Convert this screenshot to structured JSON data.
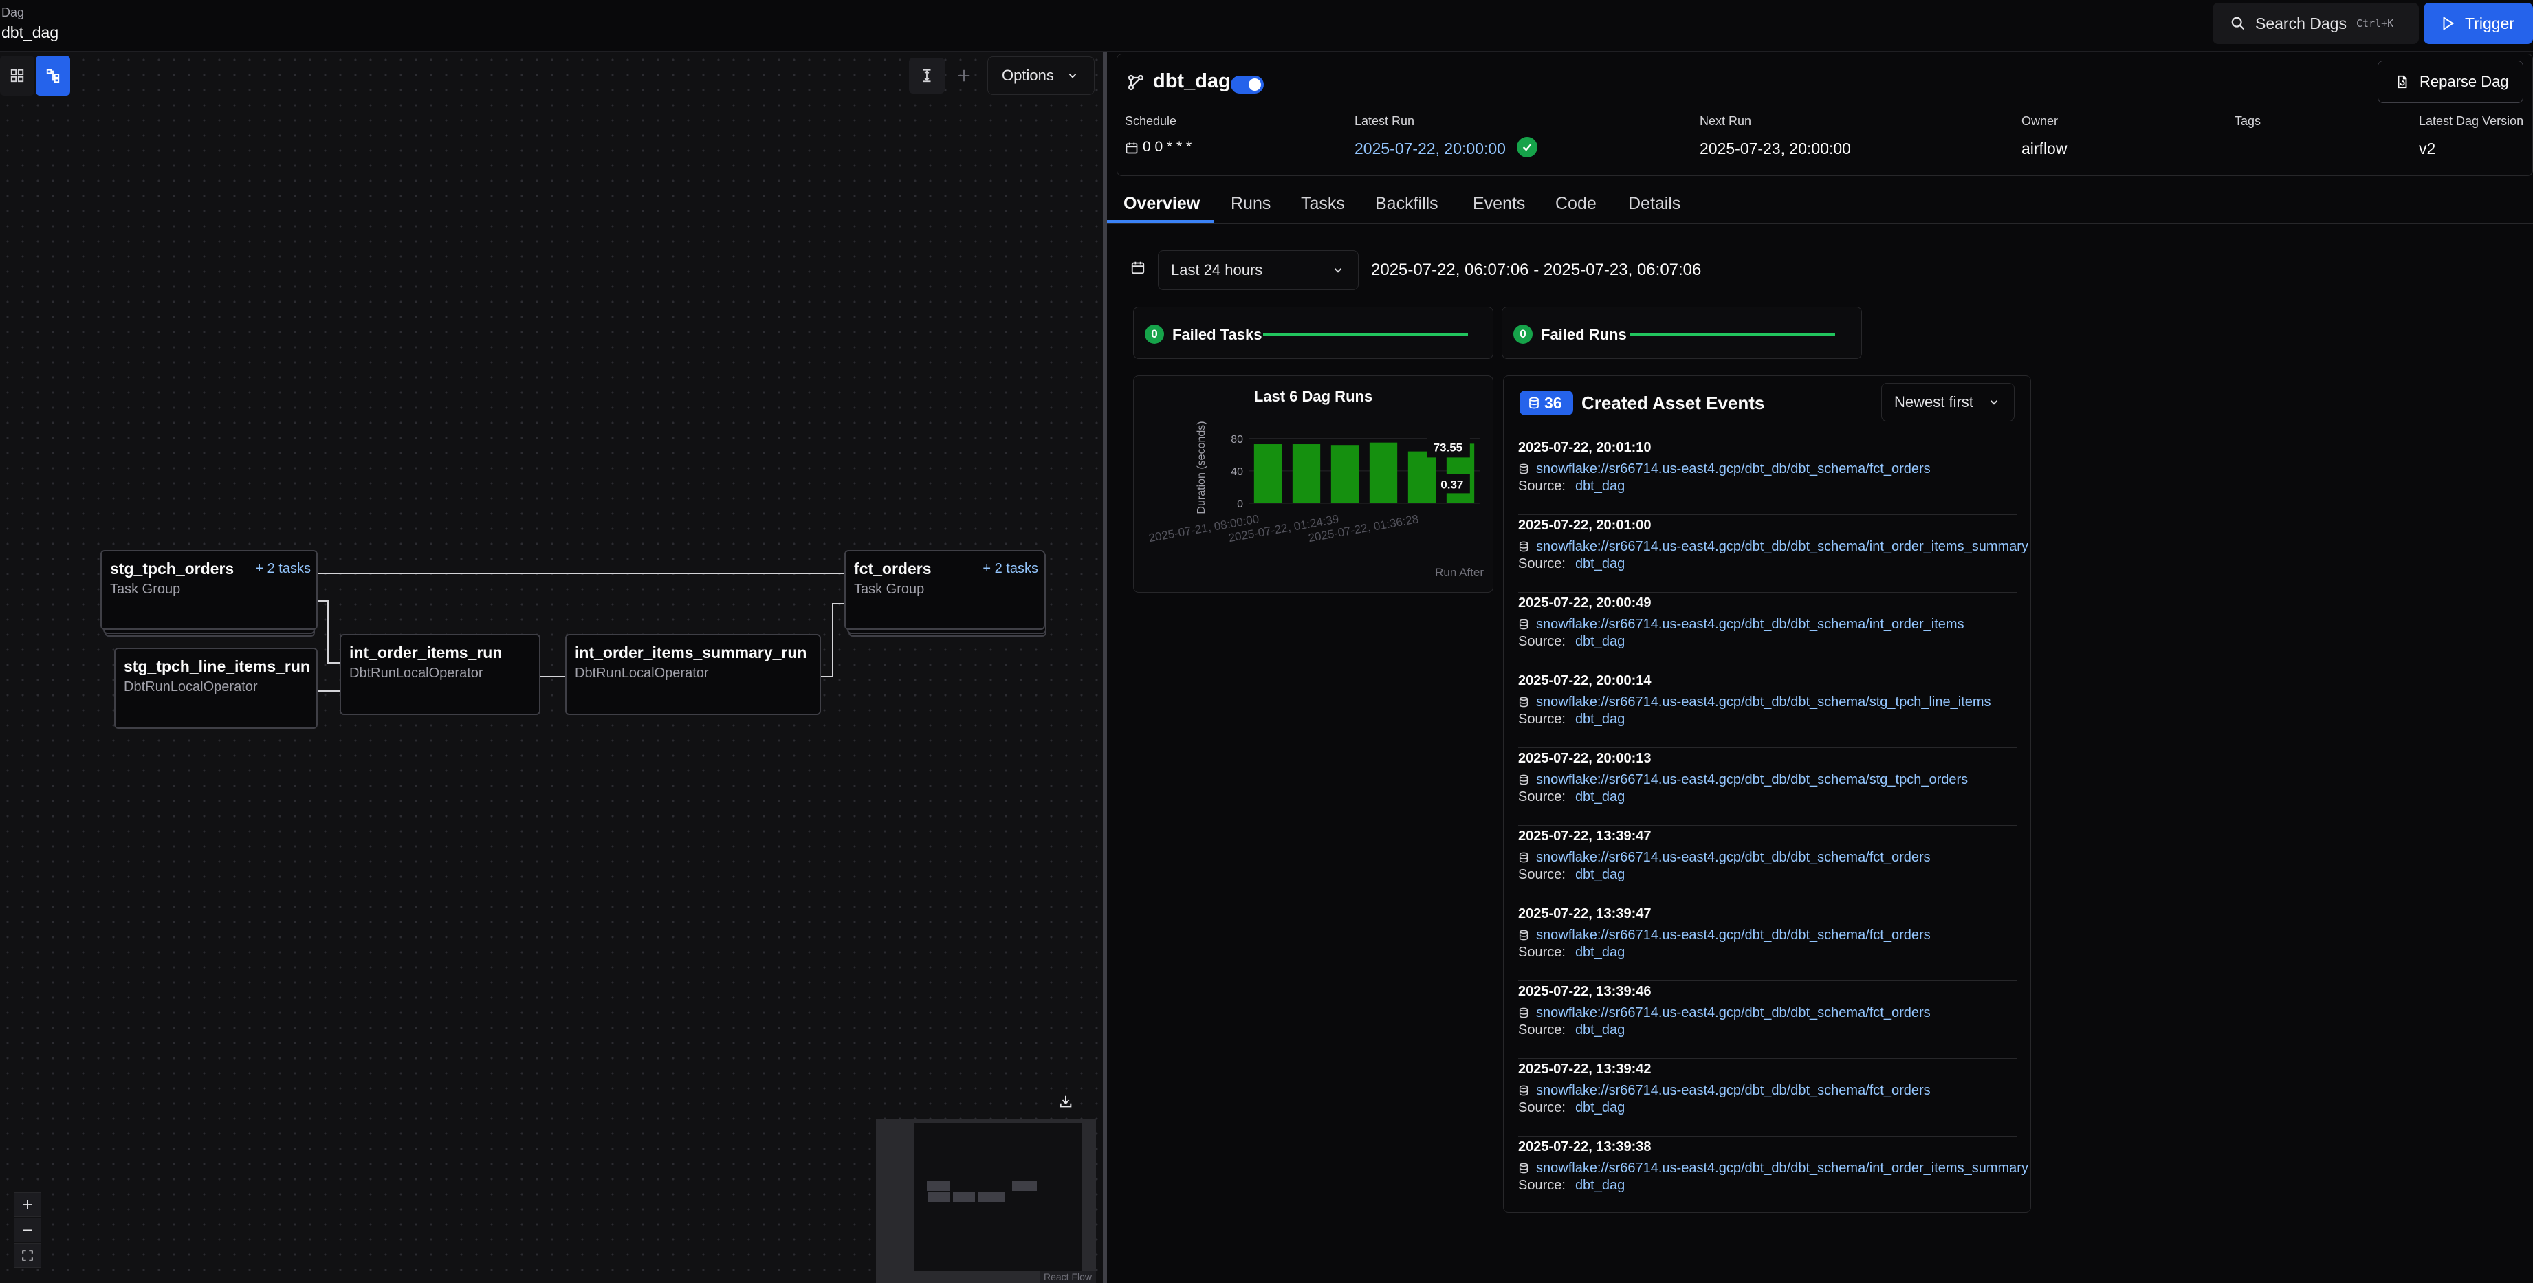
{
  "breadcrumb": {
    "section": "Dag",
    "current": "dbt_dag"
  },
  "topbar": {
    "search_label": "Search Dags",
    "search_shortcut": "Ctrl+K",
    "trigger_label": "Trigger"
  },
  "graph": {
    "options_label": "Options",
    "nodes": {
      "stg_tpch_orders": {
        "name": "stg_tpch_orders",
        "type": "Task Group",
        "more": "+ 2 tasks"
      },
      "stg_tpch_line_items_run": {
        "name": "stg_tpch_line_items_run",
        "type": "DbtRunLocalOperator"
      },
      "int_order_items_run": {
        "name": "int_order_items_run",
        "type": "DbtRunLocalOperator"
      },
      "int_order_items_summary_run": {
        "name": "int_order_items_summary_run",
        "type": "DbtRunLocalOperator"
      },
      "fct_orders": {
        "name": "fct_orders",
        "type": "Task Group",
        "more": "+ 2 tasks"
      }
    },
    "zoom_in": "+",
    "zoom_out": "−",
    "attribution": "React Flow"
  },
  "dag": {
    "title": "dbt_dag",
    "reparse_label": "Reparse Dag",
    "meta": {
      "schedule": {
        "label": "Schedule",
        "value": "0 0 * * *"
      },
      "latest_run": {
        "label": "Latest Run",
        "value": "2025-07-22, 20:00:00"
      },
      "next_run": {
        "label": "Next Run",
        "value": "2025-07-23, 20:00:00"
      },
      "owner": {
        "label": "Owner",
        "value": "airflow"
      },
      "tags": {
        "label": "Tags",
        "value": ""
      },
      "version": {
        "label": "Latest Dag Version",
        "value": "v2"
      }
    }
  },
  "tabs": [
    "Overview",
    "Runs",
    "Tasks",
    "Backfills",
    "Events",
    "Code",
    "Details"
  ],
  "overview": {
    "range_label": "Last 24 hours",
    "range_text": "2025-07-22, 06:07:06 - 2025-07-23, 06:07:06",
    "failed_tasks": {
      "count": "0",
      "label": "Failed Tasks"
    },
    "failed_runs": {
      "count": "0",
      "label": "Failed Runs"
    }
  },
  "chart_data": {
    "type": "bar",
    "title": "Last 6 Dag Runs",
    "ylabel": "Duration (seconds)",
    "xlabel": "Run After",
    "ylim": [
      0,
      90
    ],
    "yticks": [
      "0",
      "40",
      "80"
    ],
    "xticklabels": [
      "2025-07-21, 08:00:00",
      "2025-07-22, 01:24:39",
      "2025-07-22, 01:36:28"
    ],
    "values": [
      73,
      73,
      72,
      75,
      64,
      73.55
    ],
    "annotations": [
      "73.55",
      "0.37"
    ],
    "bar_color": "#15900f"
  },
  "events": {
    "count": "36",
    "title": "Created Asset Events",
    "sort_label": "Newest first",
    "source_label": "Source:",
    "items": [
      {
        "time": "2025-07-22, 20:01:10",
        "uri": "snowflake://sr66714.us-east4.gcp/dbt_db/dbt_schema/fct_orders",
        "source": "dbt_dag"
      },
      {
        "time": "2025-07-22, 20:01:00",
        "uri": "snowflake://sr66714.us-east4.gcp/dbt_db/dbt_schema/int_order_items_summary",
        "source": "dbt_dag"
      },
      {
        "time": "2025-07-22, 20:00:49",
        "uri": "snowflake://sr66714.us-east4.gcp/dbt_db/dbt_schema/int_order_items",
        "source": "dbt_dag"
      },
      {
        "time": "2025-07-22, 20:00:14",
        "uri": "snowflake://sr66714.us-east4.gcp/dbt_db/dbt_schema/stg_tpch_line_items",
        "source": "dbt_dag"
      },
      {
        "time": "2025-07-22, 20:00:13",
        "uri": "snowflake://sr66714.us-east4.gcp/dbt_db/dbt_schema/stg_tpch_orders",
        "source": "dbt_dag"
      },
      {
        "time": "2025-07-22, 13:39:47",
        "uri": "snowflake://sr66714.us-east4.gcp/dbt_db/dbt_schema/fct_orders",
        "source": "dbt_dag"
      },
      {
        "time": "2025-07-22, 13:39:47",
        "uri": "snowflake://sr66714.us-east4.gcp/dbt_db/dbt_schema/fct_orders",
        "source": "dbt_dag"
      },
      {
        "time": "2025-07-22, 13:39:46",
        "uri": "snowflake://sr66714.us-east4.gcp/dbt_db/dbt_schema/fct_orders",
        "source": "dbt_dag"
      },
      {
        "time": "2025-07-22, 13:39:42",
        "uri": "snowflake://sr66714.us-east4.gcp/dbt_db/dbt_schema/fct_orders",
        "source": "dbt_dag"
      },
      {
        "time": "2025-07-22, 13:39:38",
        "uri": "snowflake://sr66714.us-east4.gcp/dbt_db/dbt_schema/int_order_items_summary",
        "source": "dbt_dag"
      }
    ]
  }
}
